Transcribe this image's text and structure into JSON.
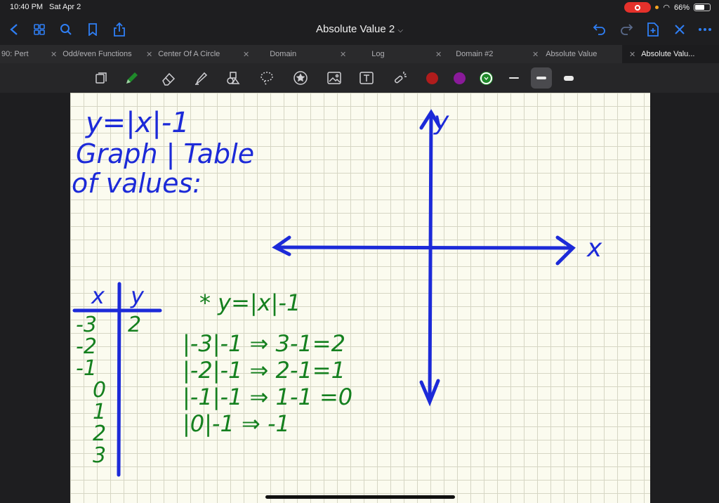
{
  "status": {
    "time": "10:40 PM",
    "date": "Sat Apr 2",
    "battery": "66%",
    "battery_level": 0.66
  },
  "nav": {
    "title": "Absolute Value 2",
    "icons": [
      "back-icon",
      "grid-icon",
      "search-icon",
      "bookmark-icon",
      "share-icon",
      "undo-icon",
      "redo-icon",
      "add-page-icon",
      "close-icon",
      "more-icon"
    ]
  },
  "tabs": [
    {
      "label": "90: Pert"
    },
    {
      "label": "Odd/even Functions"
    },
    {
      "label": "Center Of A Circle"
    },
    {
      "label": "Domain"
    },
    {
      "label": "Log"
    },
    {
      "label": "Domain #2"
    },
    {
      "label": "Absolute Value"
    },
    {
      "label": "Absolute Valu..."
    }
  ],
  "toolbar": {
    "tools": [
      "lasso-select-icon",
      "pen-icon",
      "eraser-icon",
      "highlighter-icon",
      "shapes-icon",
      "lasso-icon",
      "sticker-icon",
      "image-icon",
      "text-icon",
      "laser-pointer-icon"
    ],
    "colors": [
      "#b01c1c",
      "#8a1a9a",
      "#1f8a2a"
    ],
    "accent": "#2f7ff5"
  },
  "notes": {
    "title_line1": "y=|x|-1",
    "title_line2": "Graph | Table",
    "title_line3": "of values:",
    "axis_y": "y",
    "axis_x": "x",
    "table_header_x": "x",
    "table_header_y": "y",
    "table_x": [
      "-3",
      "-2",
      "-1",
      "0",
      "1",
      "2",
      "3"
    ],
    "table_y": [
      "2"
    ],
    "work_header": "* y=|x|-1",
    "work_lines": [
      "|-3|-1 ⇒ 3-1=2",
      "|-2|-1 ⇒ 2-1=1",
      "|-1|-1 ⇒ 1-1 =0",
      "|0|-1 ⇒ -1"
    ],
    "ink_blue": "#1c2ad8",
    "ink_green": "#15801f"
  }
}
